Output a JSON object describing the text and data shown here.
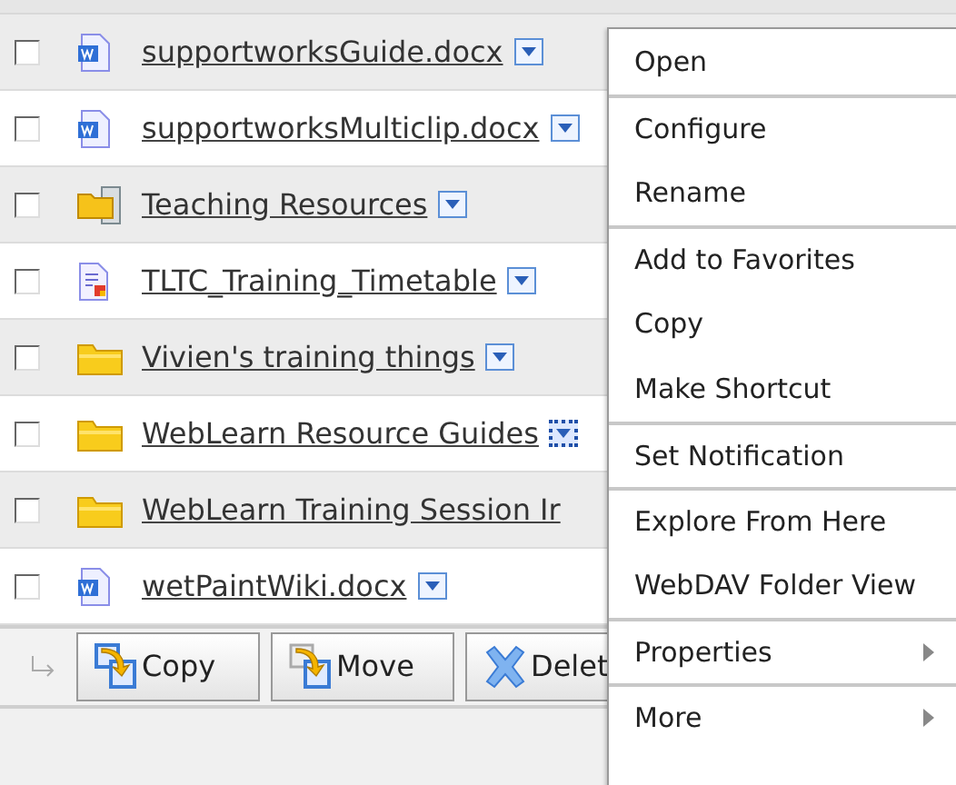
{
  "rows": [
    {
      "name": "supportworksGuide.docx",
      "kind": "word",
      "checked": false,
      "menu_button": true,
      "focused": false
    },
    {
      "name": "supportworksMulticlip.docx",
      "kind": "word",
      "checked": false,
      "menu_button": true,
      "focused": false
    },
    {
      "name": "Teaching Resources",
      "kind": "shared_folder",
      "checked": false,
      "menu_button": true,
      "focused": false
    },
    {
      "name": "TLTC_Training_Timetable",
      "kind": "timetable",
      "checked": false,
      "menu_button": true,
      "focused": false
    },
    {
      "name": "Vivien's training things",
      "kind": "folder",
      "checked": false,
      "menu_button": true,
      "focused": false
    },
    {
      "name": "WebLearn Resource Guides",
      "kind": "folder",
      "checked": false,
      "menu_button": true,
      "focused": true
    },
    {
      "name": "WebLearn Training Session Ir",
      "kind": "folder",
      "checked": false,
      "menu_button": false,
      "focused": false
    },
    {
      "name": "wetPaintWiki.docx",
      "kind": "word",
      "checked": false,
      "menu_button": true,
      "focused": false
    }
  ],
  "actions": [
    {
      "label": "Copy",
      "kind": "copy"
    },
    {
      "label": "Move",
      "kind": "move"
    },
    {
      "label": "Delet",
      "kind": "delete"
    }
  ],
  "context_menu": [
    {
      "label": "Open",
      "separator_before": false,
      "submenu": false
    },
    {
      "label": "Configure",
      "separator_before": true,
      "submenu": false
    },
    {
      "label": "Rename",
      "separator_before": false,
      "submenu": false
    },
    {
      "label": "Add to Favorites",
      "separator_before": true,
      "submenu": false
    },
    {
      "label": "Copy",
      "separator_before": false,
      "submenu": false
    },
    {
      "label": "Make Shortcut",
      "separator_before": false,
      "submenu": false
    },
    {
      "label": "Set Notification",
      "separator_before": true,
      "submenu": false
    },
    {
      "label": "Explore From Here",
      "separator_before": true,
      "submenu": false
    },
    {
      "label": "WebDAV Folder View",
      "separator_before": false,
      "submenu": false
    },
    {
      "label": "Properties",
      "separator_before": true,
      "submenu": true
    },
    {
      "label": "More",
      "separator_before": true,
      "submenu": true
    }
  ]
}
